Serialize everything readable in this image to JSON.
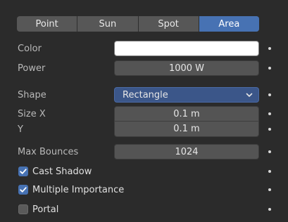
{
  "light_types": {
    "options": [
      "Point",
      "Sun",
      "Spot",
      "Area"
    ],
    "active": "Area"
  },
  "color": {
    "label": "Color",
    "value": "#ffffff"
  },
  "power": {
    "label": "Power",
    "value": "1000 W"
  },
  "shape": {
    "label": "Shape",
    "value": "Rectangle"
  },
  "size_x": {
    "label": "Size X",
    "value": "0.1 m"
  },
  "size_y": {
    "label": "Y",
    "value": "0.1 m"
  },
  "max_bounces": {
    "label": "Max Bounces",
    "value": "1024"
  },
  "cast_shadow": {
    "label": "Cast Shadow",
    "checked": true
  },
  "multiple_importance": {
    "label": "Multiple Importance",
    "checked": true
  },
  "portal": {
    "label": "Portal",
    "checked": false
  },
  "colors": {
    "accent": "#4772b3",
    "select": "#3b5689"
  }
}
